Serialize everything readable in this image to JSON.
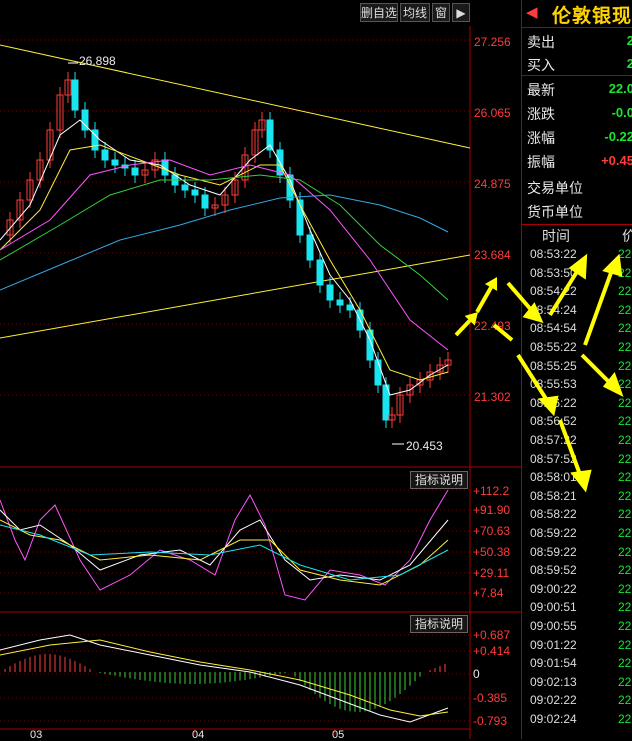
{
  "toolbar": {
    "btn1": "删自选",
    "btn2": "均线",
    "btn3": "窗",
    "btn4": "▶"
  },
  "price_axis": [
    "27.256",
    "26.065",
    "24.875",
    "23.684",
    "22.493",
    "21.302"
  ],
  "annotations": {
    "high": "26.898",
    "low": "20.453"
  },
  "indicator1": {
    "button": "指标说明",
    "axis": [
      "+112.2",
      "+91.90",
      "+70.63",
      "+50.38",
      "+29.11",
      "+7.84"
    ]
  },
  "indicator2": {
    "button": "指标说明",
    "axis": [
      "+0.687",
      "+0.414",
      "0",
      "-0.385",
      "-0.793"
    ]
  },
  "months": [
    "03",
    "04",
    "05"
  ],
  "quote": {
    "title": "伦敦银现",
    "rows": [
      {
        "label": "卖出",
        "value": "2"
      },
      {
        "label": "买入",
        "value": "2"
      },
      {
        "label": "最新",
        "value": "22.0"
      },
      {
        "label": "涨跌",
        "value": "-0.0"
      },
      {
        "label": "涨幅",
        "value": "-0.22"
      },
      {
        "label": "振幅",
        "value": "+0.45"
      },
      {
        "label": "交易单位",
        "value": ""
      },
      {
        "label": "货币单位",
        "value": ""
      }
    ]
  },
  "ticks": {
    "header_time": "时间",
    "header_price": "价",
    "times": [
      "08:53:22",
      "08:53:50",
      "08:54:22",
      "08:54:24",
      "08:54:54",
      "08:55:22",
      "08:55:25",
      "08:55:53",
      "08:56:22",
      "08:56:52",
      "08:57:22",
      "08:57:52",
      "08:58:01",
      "08:58:21",
      "08:58:22",
      "08:59:22",
      "08:59:22",
      "08:59:52",
      "09:00:22",
      "09:00:51",
      "09:00:55",
      "09:01:22",
      "09:01:54",
      "09:02:13",
      "09:02:22",
      "09:02:24"
    ],
    "price_prefix": "22"
  },
  "colors": {
    "up": "#ff3b3b",
    "down": "#19e5f0",
    "ma_white": "#ffffff",
    "ma_yellow": "#ffef3a",
    "ma_pink": "#ff55ff",
    "ma_green": "#34d23a",
    "ma_blue": "#35a5e6",
    "arrow": "#ffff00"
  }
}
